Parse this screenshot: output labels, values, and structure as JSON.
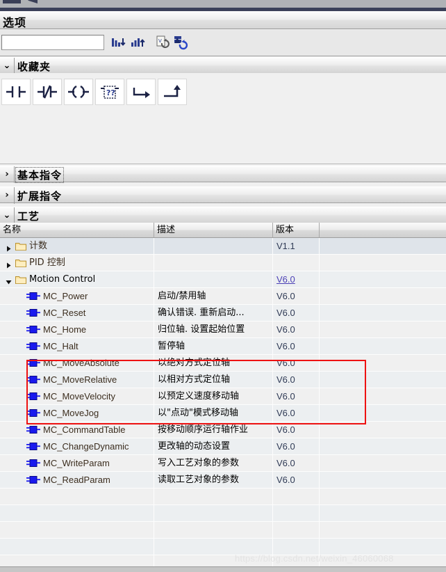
{
  "panel": {
    "title": "选项",
    "search": {
      "value": "",
      "placeholder": ""
    },
    "toolbar": [
      {
        "name": "sort-descending-icon",
        "label": "降序排序"
      },
      {
        "name": "sort-ascending-icon",
        "label": "升序排序"
      },
      {
        "name": "update-accessible-devices-icon",
        "label": "更新"
      },
      {
        "name": "refresh-blocks-icon",
        "label": "刷新"
      }
    ]
  },
  "sections": [
    {
      "id": "favorites",
      "label": "收藏夹",
      "expanded": true,
      "arrow": "⌄",
      "focused": false
    },
    {
      "id": "basic",
      "label": "基本指令",
      "expanded": false,
      "arrow": "›",
      "focused": true
    },
    {
      "id": "extended",
      "label": "扩展指令",
      "expanded": false,
      "arrow": "›",
      "focused": false
    },
    {
      "id": "technology",
      "label": "工艺",
      "expanded": true,
      "arrow": "⌄",
      "focused": false
    }
  ],
  "favorites": [
    {
      "name": "no-contact-icon",
      "label": "常开触点"
    },
    {
      "name": "nc-contact-icon",
      "label": "常闭触点"
    },
    {
      "name": "coil-icon",
      "label": "输出线圈"
    },
    {
      "name": "empty-box-icon",
      "label": "空功能框"
    },
    {
      "name": "open-branch-icon",
      "label": "打开分支"
    },
    {
      "name": "close-branch-icon",
      "label": "关闭分支"
    }
  ],
  "table": {
    "columns": [
      {
        "key": "name",
        "label": "名称"
      },
      {
        "key": "desc",
        "label": "描述"
      },
      {
        "key": "version",
        "label": "版本"
      },
      {
        "key": "extra",
        "label": ""
      }
    ],
    "rows": [
      {
        "kind": "folder",
        "indent": 0,
        "twisty": "collapsed",
        "name": "计数",
        "desc": "",
        "version": "V1.1",
        "selected": true,
        "link": false
      },
      {
        "kind": "folder",
        "indent": 0,
        "twisty": "collapsed",
        "name": "PID 控制",
        "desc": "",
        "version": "",
        "selected": false,
        "link": false
      },
      {
        "kind": "folder",
        "indent": 0,
        "twisty": "expanded",
        "name": "Motion Control",
        "desc": "",
        "version": "V6.0",
        "selected": false,
        "link": true
      },
      {
        "kind": "block",
        "indent": 1,
        "name": "MC_Power",
        "desc": "启动/禁用轴",
        "version": "V6.0"
      },
      {
        "kind": "block",
        "indent": 1,
        "name": "MC_Reset",
        "desc": "确认错误. 重新启动...",
        "version": "V6.0"
      },
      {
        "kind": "block",
        "indent": 1,
        "name": "MC_Home",
        "desc": "归位轴. 设置起始位置",
        "version": "V6.0"
      },
      {
        "kind": "block",
        "indent": 1,
        "name": "MC_Halt",
        "desc": "暂停轴",
        "version": "V6.0"
      },
      {
        "kind": "block",
        "indent": 1,
        "name": "MC_MoveAbsolute",
        "desc": "以绝对方式定位轴",
        "version": "V6.0"
      },
      {
        "kind": "block",
        "indent": 1,
        "name": "MC_MoveRelative",
        "desc": "以相对方式定位轴",
        "version": "V6.0"
      },
      {
        "kind": "block",
        "indent": 1,
        "name": "MC_MoveVelocity",
        "desc": "以预定义速度移动轴",
        "version": "V6.0"
      },
      {
        "kind": "block",
        "indent": 1,
        "name": "MC_MoveJog",
        "desc": "以\"点动\"模式移动轴",
        "version": "V6.0"
      },
      {
        "kind": "block",
        "indent": 1,
        "name": "MC_CommandTable",
        "desc": "按移动顺序运行轴作业",
        "version": "V6.0"
      },
      {
        "kind": "block",
        "indent": 1,
        "name": "MC_ChangeDynamic",
        "desc": "更改轴的动态设置",
        "version": "V6.0"
      },
      {
        "kind": "block",
        "indent": 1,
        "name": "MC_WriteParam",
        "desc": "写入工艺对象的参数",
        "version": "V6.0"
      },
      {
        "kind": "block",
        "indent": 1,
        "name": "MC_ReadParam",
        "desc": "读取工艺对象的参数",
        "version": "V6.0"
      }
    ]
  },
  "annotation": {
    "highlight_box": {
      "color": "#ee1111",
      "rows": [
        "MC_MoveAbsolute",
        "MC_MoveRelative",
        "MC_MoveVelocity",
        "MC_MoveJog"
      ]
    }
  },
  "watermark": {
    "text": "https://blog.csdn.net/weixin_46060068"
  },
  "colors": {
    "accent": "#2a3c8f",
    "link": "#4a3fb5",
    "highlight": "#ee1111",
    "selection": "#dfe4ea"
  }
}
